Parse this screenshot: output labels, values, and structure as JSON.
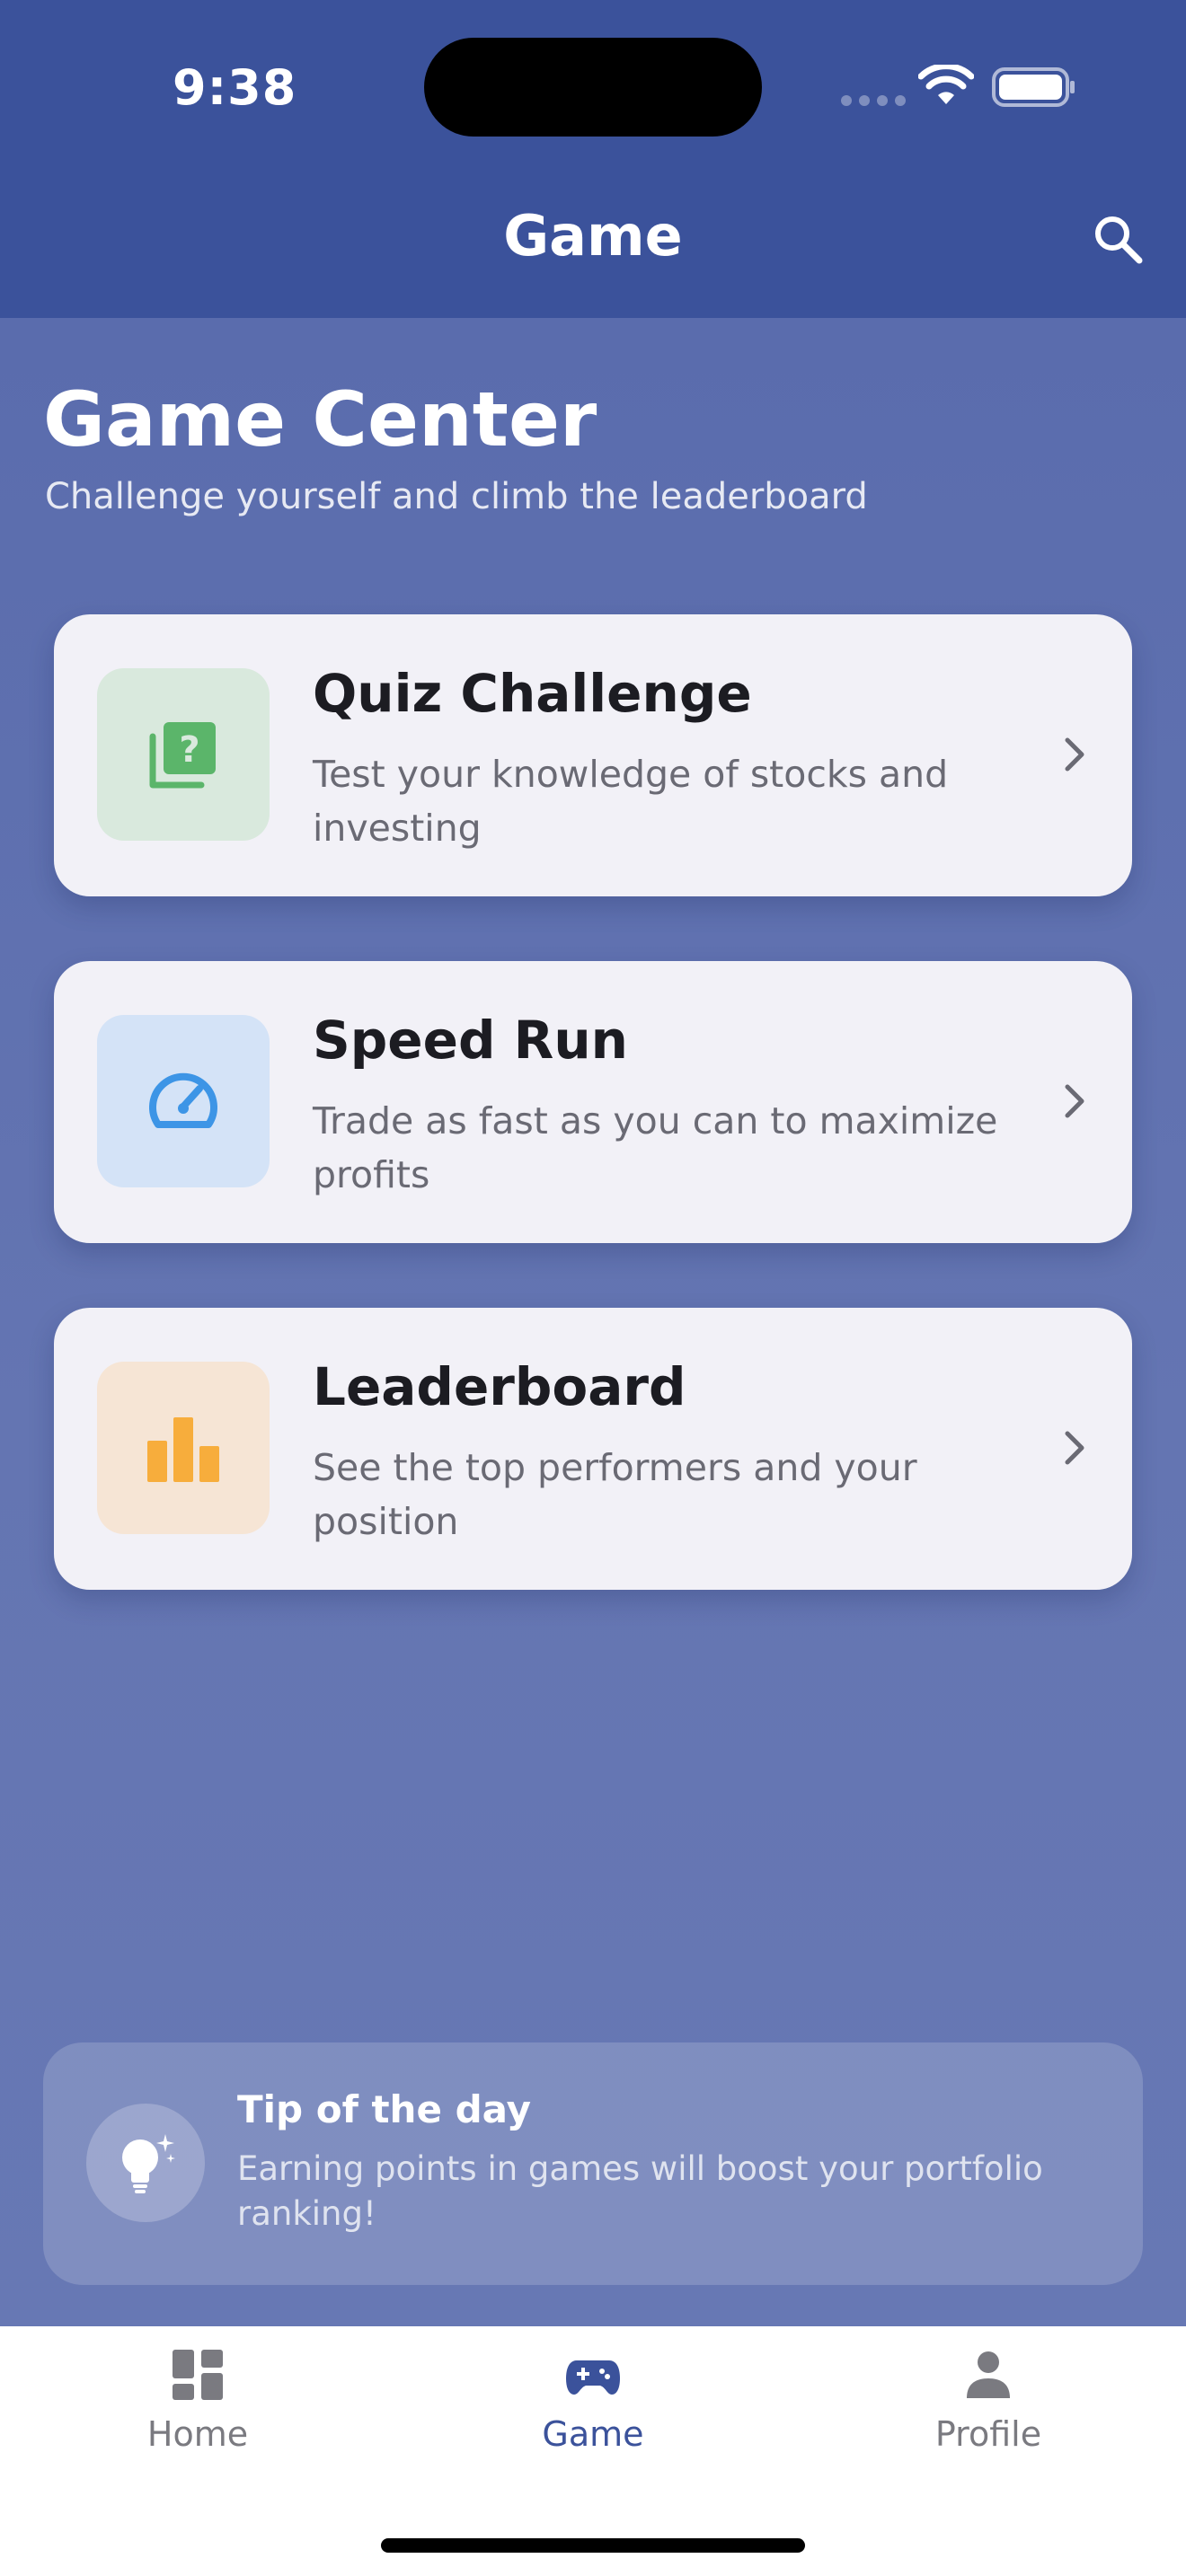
{
  "status_bar": {
    "time": "9:38"
  },
  "nav": {
    "title": "Game",
    "search_icon": "search-icon"
  },
  "header": {
    "title": "Game Center",
    "subtitle": "Challenge yourself and climb the leaderboard"
  },
  "cards": [
    {
      "title": "Quiz Challenge",
      "description": "Test your knowledge of stocks and investing",
      "icon": "quiz-icon",
      "icon_bg": "#d9e9dd",
      "icon_color": "#5bb56a"
    },
    {
      "title": "Speed Run",
      "description": "Trade as fast as you can to maximize profits",
      "icon": "speedometer-icon",
      "icon_bg": "#d4e3f7",
      "icon_color": "#3d95e6"
    },
    {
      "title": "Leaderboard",
      "description": "See the top performers and your position",
      "icon": "bar-chart-icon",
      "icon_bg": "#f6e5d5",
      "icon_color": "#f7ad3c"
    }
  ],
  "tip": {
    "title": "Tip of the day",
    "text": "Earning points in games will boost your portfolio ranking!",
    "icon": "lightbulb-icon"
  },
  "tabbar": {
    "items": [
      {
        "label": "Home",
        "icon": "dashboard-icon",
        "active": false
      },
      {
        "label": "Game",
        "icon": "gamepad-icon",
        "active": true
      },
      {
        "label": "Profile",
        "icon": "person-icon",
        "active": false
      }
    ]
  },
  "colors": {
    "header_bg": "#3b529b",
    "content_bg": "#5a6cad",
    "card_bg": "#f2f1f7",
    "active_tab": "#3b529b"
  }
}
